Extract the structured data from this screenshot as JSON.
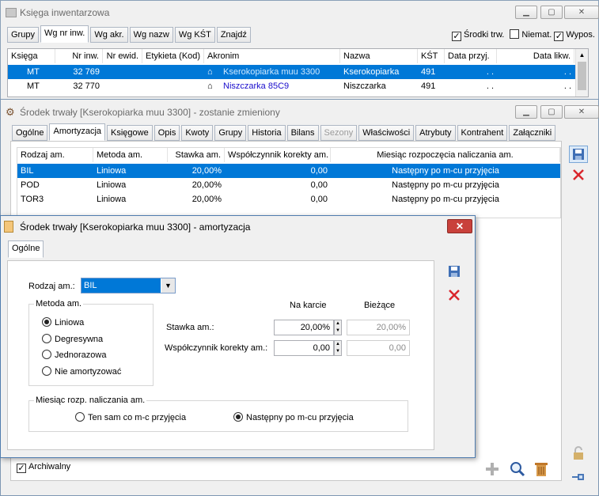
{
  "win1": {
    "title": "Księga inwentarzowa",
    "tabs": [
      "Grupy",
      "Wg nr inw.",
      "Wg akr.",
      "Wg nazw",
      "Wg KŚT",
      "Znajdź"
    ],
    "checks": [
      {
        "label": "Środki trw.",
        "checked": true
      },
      {
        "label": "Niemat.",
        "checked": false
      },
      {
        "label": "Wypos.",
        "checked": true
      }
    ],
    "columns": [
      "Księga",
      "Nr inw.",
      "Nr ewid.",
      "Etykieta (Kod)",
      "Akronim",
      "Nazwa",
      "KŚT",
      "Data przyj.",
      "Data likw."
    ],
    "rows": [
      {
        "ksiega": "MT",
        "nr_inw": "32 769",
        "akronim": "Kserokopiarka muu 3300",
        "nazwa": "Kserokopiarka",
        "kst": "491",
        "data_przyj": ". .",
        "data_likw": ". ."
      },
      {
        "ksiega": "MT",
        "nr_inw": "32 770",
        "akronim": "Niszczarka 85C9",
        "nazwa": "Niszczarka",
        "kst": "491",
        "data_przyj": ". .",
        "data_likw": ". ."
      }
    ]
  },
  "win2": {
    "title": "Środek trwały [Kserokopiarka muu 3300] - zostanie zmieniony",
    "tabs": [
      "Ogólne",
      "Amortyzacja",
      "Księgowe",
      "Opis",
      "Kwoty",
      "Grupy",
      "Historia",
      "Bilans",
      "Sezony",
      "Właściwości",
      "Atrybuty",
      "Kontrahent",
      "Załączniki"
    ],
    "columns": [
      "Rodzaj am.",
      "Metoda am.",
      "Stawka am.",
      "Współczynnik korekty am.",
      "Miesiąc rozpoczęcia naliczania am."
    ],
    "rows": [
      {
        "rodzaj": "BIL",
        "metoda": "Liniowa",
        "stawka": "20,00%",
        "wsp": "0,00",
        "miesiac": "Następny po m-cu przyjęcia"
      },
      {
        "rodzaj": "POD",
        "metoda": "Liniowa",
        "stawka": "20,00%",
        "wsp": "0,00",
        "miesiac": "Następny po m-cu przyjęcia"
      },
      {
        "rodzaj": "TOR3",
        "metoda": "Liniowa",
        "stawka": "20,00%",
        "wsp": "0,00",
        "miesiac": "Następny po m-cu przyjęcia"
      }
    ],
    "archiwalny_label": "Archiwalny"
  },
  "win3": {
    "title": "Środek trwały [Kserokopiarka muu 3300] - amortyzacja",
    "tab": "Ogólne",
    "rodzaj_label": "Rodzaj am.:",
    "rodzaj_value": "BIL",
    "metoda_legend": "Metoda am.",
    "metody": [
      "Liniowa",
      "Degresywna",
      "Jednorazowa",
      "Nie amortyzować"
    ],
    "na_karcie": "Na karcie",
    "biezace": "Bieżące",
    "stawka_label": "Stawka am.:",
    "stawka_karta": "20,00%",
    "stawka_biezace": "20,00%",
    "wsp_label": "Współczynnik korekty am.:",
    "wsp_karta": "0,00",
    "wsp_biezace": "0,00",
    "miesiac_legend": "Miesiąc rozp. naliczania am.",
    "miesiac_opt1": "Ten sam co m-c przyjęcia",
    "miesiac_opt2": "Następny po m-cu przyjęcia"
  },
  "colors": {
    "selection": "#0078d7",
    "link": "#1a0dcc",
    "delete": "#d9262c"
  }
}
